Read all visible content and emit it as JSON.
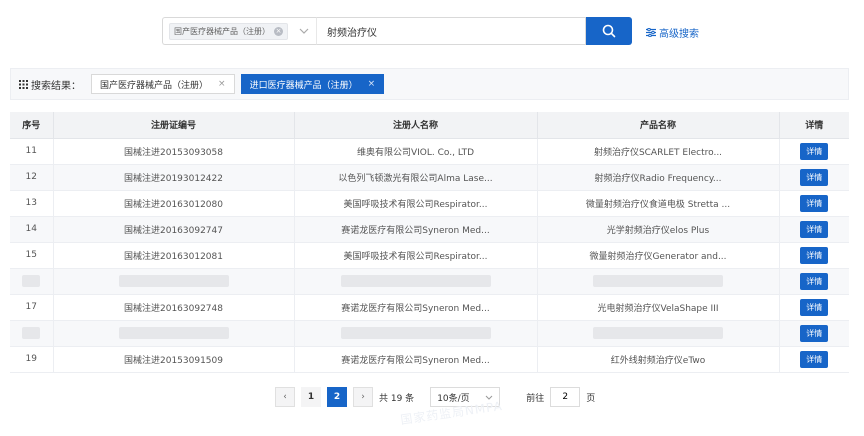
{
  "search": {
    "category_tag": "国产医疗器械产品（注册）",
    "query": "射频治疗仪",
    "advanced_label": "高级搜索"
  },
  "results": {
    "label": "搜索结果：",
    "tabs": [
      {
        "label": "国产医疗器械产品（注册）",
        "active": false
      },
      {
        "label": "进口医疗器械产品（注册）",
        "active": true
      }
    ]
  },
  "table": {
    "headers": [
      "序号",
      "注册证编号",
      "注册人名称",
      "产品名称",
      "详情"
    ],
    "detail_label": "详情",
    "rows": [
      {
        "no": "11",
        "reg": "国械注进20153093058",
        "company": "维奥有限公司VIOL. Co., LTD",
        "product": "射频治疗仪SCARLET Electro...",
        "hidden": false
      },
      {
        "no": "12",
        "reg": "国械注进20193012422",
        "company": "以色列飞顿激光有限公司Alma Lase...",
        "product": "射频治疗仪Radio Frequency...",
        "hidden": false
      },
      {
        "no": "13",
        "reg": "国械注进20163012080",
        "company": "美国呼吸技术有限公司Respirator...",
        "product": "微量射频治疗仪食道电极 Stretta ...",
        "hidden": false
      },
      {
        "no": "14",
        "reg": "国械注进20163092747",
        "company": "赛诺龙医疗有限公司Syneron Med...",
        "product": "光学射频治疗仪elos Plus",
        "hidden": false
      },
      {
        "no": "15",
        "reg": "国械注进20163012081",
        "company": "美国呼吸技术有限公司Respirator...",
        "product": "微量射频治疗仪Generator and...",
        "hidden": false
      },
      {
        "no": "",
        "reg": "",
        "company": "",
        "product": "",
        "hidden": true
      },
      {
        "no": "17",
        "reg": "国械注进20163092748",
        "company": "赛诺龙医疗有限公司Syneron Med...",
        "product": "光电射频治疗仪VelaShape III",
        "hidden": false
      },
      {
        "no": "",
        "reg": "",
        "company": "",
        "product": "",
        "hidden": true
      },
      {
        "no": "19",
        "reg": "国械注进20153091509",
        "company": "赛诺龙医疗有限公司Syneron Med...",
        "product": "红外线射频治疗仪eTwo",
        "hidden": false
      }
    ]
  },
  "pagination": {
    "prev": "‹",
    "next": "›",
    "pages": [
      "1",
      "2"
    ],
    "current": "2",
    "total": "共 19 条",
    "page_size": "10条/页",
    "goto_label": "前往",
    "goto_value": "2",
    "goto_suffix": "页"
  },
  "watermark": "国家药监局NMPA",
  "colors": {
    "accent": "#1765c8",
    "header_bg": "#f2f3f5"
  }
}
